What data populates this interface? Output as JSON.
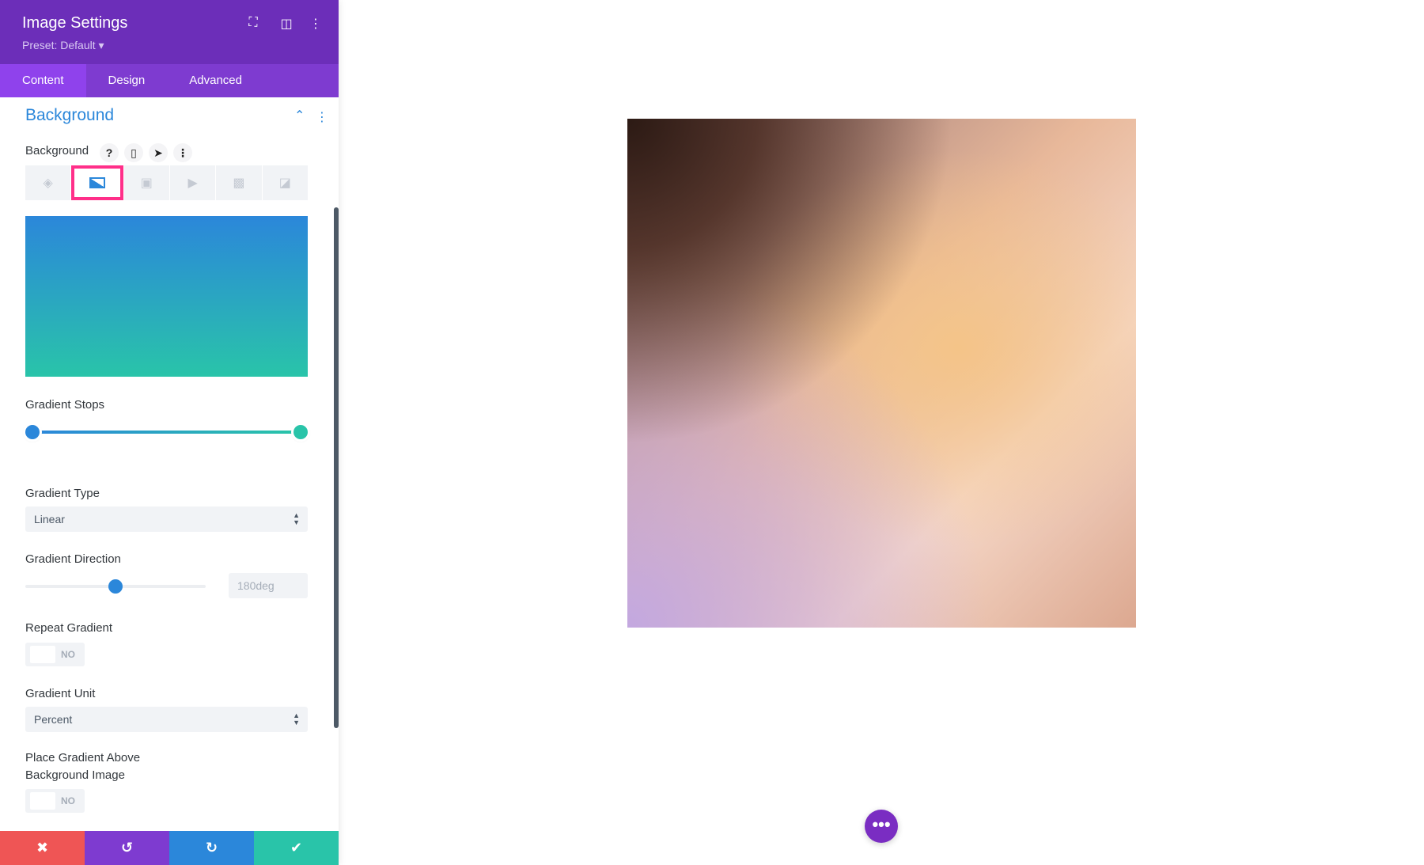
{
  "header": {
    "title": "Image Settings",
    "preset": "Preset: Default ▾",
    "icons": [
      "fullscreen-icon",
      "split-layout-icon",
      "more-vertical-icon"
    ]
  },
  "tabs": [
    {
      "label": "Content",
      "active": true
    },
    {
      "label": "Design"
    },
    {
      "label": "Advanced"
    }
  ],
  "section": {
    "title": "Background"
  },
  "background_field": {
    "label": "Background",
    "help": "?",
    "bg_types": [
      "color-icon",
      "gradient-icon",
      "image-icon",
      "video-icon",
      "pattern-icon",
      "mask-icon"
    ],
    "active_type": "gradient"
  },
  "gradient": {
    "colors": {
      "start": "#2b87da",
      "end": "#29c4a9"
    },
    "stops_label": "Gradient Stops",
    "type_label": "Gradient Type",
    "type_value": "Linear",
    "direction_label": "Gradient Direction",
    "direction_value": "180deg",
    "direction_slider_fraction": 0.5,
    "repeat_label": "Repeat Gradient",
    "repeat_value": "NO",
    "unit_label": "Gradient Unit",
    "unit_value": "Percent",
    "above_label_1": "Place Gradient Above",
    "above_label_2": "Background Image",
    "above_value": "NO"
  },
  "footer": {
    "colors": {
      "cancel": "#ef5555",
      "undo": "#7e3bd0",
      "redo": "#2b87da",
      "save": "#29c4a9"
    }
  },
  "canvas": {
    "more_button": "•••"
  }
}
